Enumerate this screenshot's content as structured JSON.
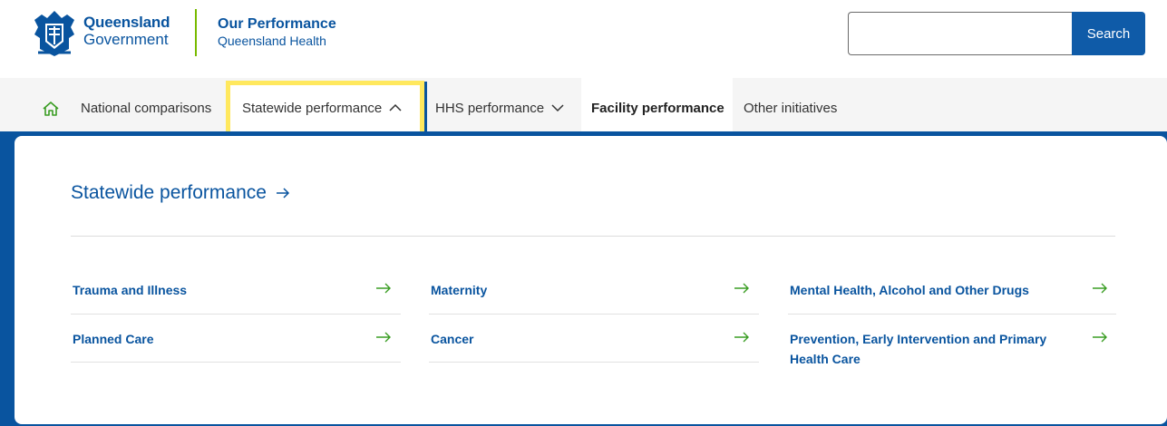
{
  "header": {
    "brand_line1": "Queensland",
    "brand_line2": "Government",
    "site_title": "Our Performance",
    "site_subtitle": "Queensland Health",
    "search_value": "",
    "search_button": "Search"
  },
  "nav": {
    "items": [
      {
        "label": "National comparisons"
      },
      {
        "label": "Statewide performance"
      },
      {
        "label": "HHS performance"
      },
      {
        "label": "Facility performance"
      },
      {
        "label": "Other initiatives"
      }
    ]
  },
  "menu": {
    "title": "Statewide performance",
    "links": [
      {
        "label": "Trauma and Illness"
      },
      {
        "label": "Maternity"
      },
      {
        "label": "Mental Health, Alcohol and Other Drugs"
      },
      {
        "label": "Planned Care"
      },
      {
        "label": "Cancer"
      },
      {
        "label": "Prevention, Early Intervention and Primary Health Care"
      }
    ]
  },
  "colors": {
    "brand_blue": "#09549f",
    "accent_green": "#78ba00",
    "highlight_yellow": "#ffe85e",
    "arrow_green": "#3a9d23"
  }
}
